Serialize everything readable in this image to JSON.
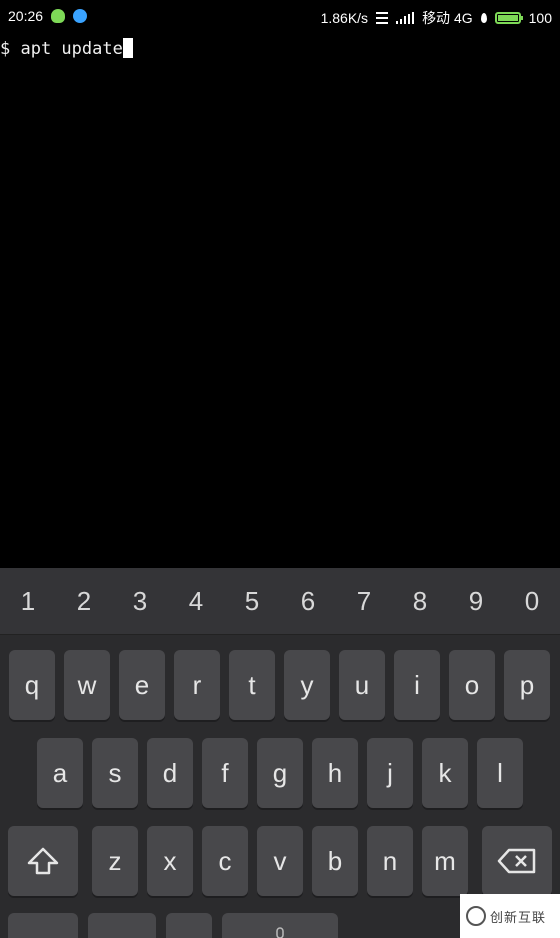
{
  "status_bar": {
    "time": "20:26",
    "net_speed": "1.86K/s",
    "carrier": "移动 4G",
    "battery": "100",
    "battery_level": 1.0,
    "icons": [
      "wechat-icon",
      "qq-icon",
      "menu-icon",
      "signal-icon",
      "location-icon",
      "battery-icon"
    ]
  },
  "terminal": {
    "prompt": "$ ",
    "command": "apt update"
  },
  "keyboard": {
    "numbers": [
      "1",
      "2",
      "3",
      "4",
      "5",
      "6",
      "7",
      "8",
      "9",
      "0"
    ],
    "row1": [
      "q",
      "w",
      "e",
      "r",
      "t",
      "y",
      "u",
      "i",
      "o",
      "p"
    ],
    "row2": [
      "a",
      "s",
      "d",
      "f",
      "g",
      "h",
      "j",
      "k",
      "l"
    ],
    "row3": [
      "z",
      "x",
      "c",
      "v",
      "b",
      "n",
      "m"
    ],
    "colors": {
      "bg": "#2b2b2d",
      "key": "#48484b",
      "numrow": "#343437"
    }
  },
  "watermark": {
    "text": "创新互联"
  }
}
